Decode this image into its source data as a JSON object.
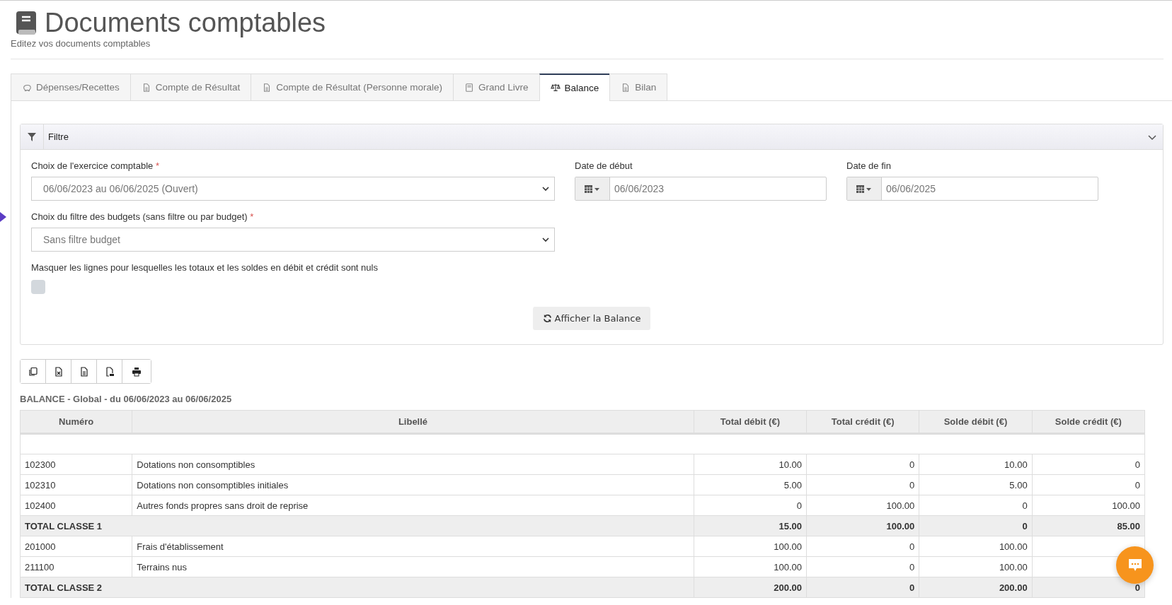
{
  "header": {
    "title": "Documents comptables",
    "subtitle": "Editez vos documents comptables"
  },
  "tabs": [
    {
      "label": "Dépenses/Recettes",
      "selected": false
    },
    {
      "label": "Compte de Résultat",
      "selected": false
    },
    {
      "label": "Compte de Résultat (Personne morale)",
      "selected": false
    },
    {
      "label": "Grand Livre",
      "selected": false
    },
    {
      "label": "Balance",
      "selected": true
    },
    {
      "label": "Bilan",
      "selected": false
    }
  ],
  "filter": {
    "title": "Filtre",
    "expanded": true,
    "exercise": {
      "label": "Choix de l'exercice comptable",
      "required_mark": "*",
      "value": "06/06/2023 au 06/06/2025 (Ouvert)"
    },
    "start_date": {
      "label": "Date de début",
      "value": "06/06/2023"
    },
    "end_date": {
      "label": "Date de fin",
      "value": "06/06/2025"
    },
    "budget": {
      "label": "Choix du filtre des budgets (sans filtre ou par budget)",
      "required_mark": "*",
      "value": "Sans filtre budget"
    },
    "hide_zero": {
      "label": "Masquer les lignes pour lesquelles les totaux et les soldes en débit et crédit sont nuls",
      "checked": false
    },
    "submit": "Afficher la Balance"
  },
  "table": {
    "caption": "BALANCE - Global - du 06/06/2023 au 06/06/2025",
    "columns": [
      "Numéro",
      "Libellé",
      "Total débit (€)",
      "Total crédit (€)",
      "Solde débit (€)",
      "Solde crédit (€)"
    ],
    "rows": [
      {
        "kind": "account",
        "number": "102300",
        "label": "Dotations non consomptibles",
        "values": [
          "10.00",
          "0",
          "10.00",
          "0"
        ]
      },
      {
        "kind": "account",
        "number": "102310",
        "label": "Dotations non consomptibles initiales",
        "values": [
          "5.00",
          "0",
          "5.00",
          "0"
        ]
      },
      {
        "kind": "account",
        "number": "102400",
        "label": "Autres fonds propres sans droit de reprise",
        "values": [
          "0",
          "100.00",
          "0",
          "100.00"
        ]
      },
      {
        "kind": "total",
        "label": "TOTAL CLASSE 1",
        "values": [
          "15.00",
          "100.00",
          "0",
          "85.00"
        ]
      },
      {
        "kind": "account",
        "number": "201000",
        "label": "Frais d'établissement",
        "values": [
          "100.00",
          "0",
          "100.00"
        ]
      },
      {
        "kind": "account",
        "number": "211100",
        "label": "Terrains nus",
        "values": [
          "100.00",
          "0",
          "100.00"
        ]
      },
      {
        "kind": "total",
        "label": "TOTAL CLASSE 2",
        "values": [
          "200.00",
          "0",
          "200.00",
          "0"
        ]
      }
    ]
  }
}
